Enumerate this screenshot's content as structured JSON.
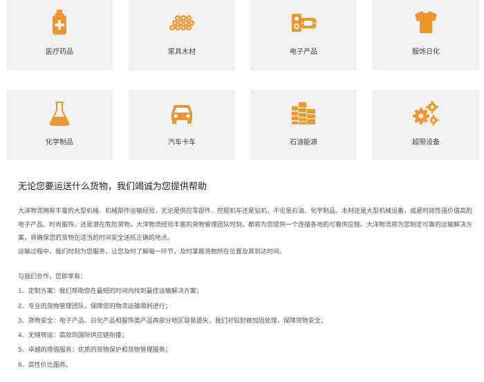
{
  "categories_row1": [
    {
      "label": "医疗药品",
      "icon": "medicine-bottle-icon"
    },
    {
      "label": "家具木材",
      "icon": "timber-logs-icon"
    },
    {
      "label": "电子产品",
      "icon": "electronics-icon"
    },
    {
      "label": "服饰日化",
      "icon": "tshirt-icon"
    }
  ],
  "categories_row2": [
    {
      "label": "化学制品",
      "icon": "flask-icon"
    },
    {
      "label": "汽车卡车",
      "icon": "car-icon"
    },
    {
      "label": "石油能源",
      "icon": "oil-tanks-icon"
    },
    {
      "label": "超限设备",
      "icon": "gears-icon"
    }
  ],
  "colors": {
    "accent": "#f0962b",
    "card_bg": "#f2f2f2"
  },
  "article": {
    "heading": "无论您要运送什么货物，我们竭诚为您提供帮助",
    "para1": "大洋物流拥有丰富的大型机械、机械部件运输经验，无论是供应零部件、挖掘机车还是钻机，不论是石油、化学制品、木材还是大型机械设备，或是时效性强价值高的电子产品、时尚服饰，还是潜在危险货物，大洋物流经验丰富的货物管理团队时刻，都将为您提供一个连接各地的可靠供应链。大洋物流将为您制定可靠的运输解决方案，将确保您的货物在适当的时间安全送抵正确的地点。",
    "para2": "运输过程中，我们时刻为您服务，让您及时了解每一环节，及时掌握货物所在位置及其到达时间。",
    "benefits_title": "与我们合作，您即享有：",
    "benefits": [
      "1、定制方案：我们帮助您在最短的时间内找到最佳运输解决方案；",
      "2、专业的货物管理团队，保障您的物流运输顺利进行；",
      "3、货物安全：电子产品、日化产品和服饰类产品再部分地区容易遗失，我们对铅封做加固处理，保障货物安全；",
      "4、无缝转运：高效的国际供应链衔接；",
      "5、卓越的增值服务：优质的货物保护和货物管理服务；",
      "6、高性价比服务。"
    ]
  }
}
